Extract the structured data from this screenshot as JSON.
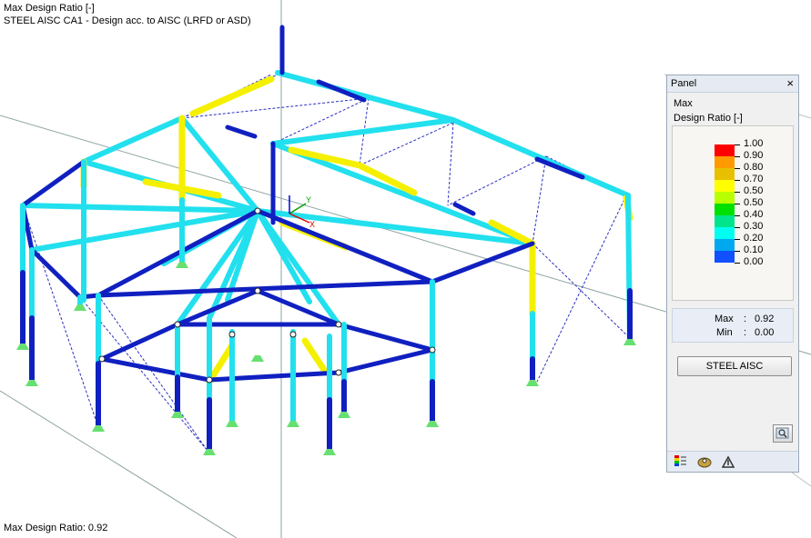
{
  "viewport": {
    "header_line1": "Max Design Ratio [-]",
    "header_line2": "STEEL AISC CA1 - Design acc. to AISC (LRFD or ASD)",
    "footer": "Max Design Ratio: 0.92",
    "axes": {
      "x": "X",
      "y": "Y"
    }
  },
  "panel": {
    "title": "Panel",
    "label1": "Max",
    "label2": "Design Ratio [-]",
    "legend": [
      {
        "value": "1.00",
        "color": "#ff0000"
      },
      {
        "value": "0.90",
        "color": "#ff9a00"
      },
      {
        "value": "0.80",
        "color": "#e8c000"
      },
      {
        "value": "0.70",
        "color": "#ffff00"
      },
      {
        "value": "0.50",
        "color": "#b8ff00"
      },
      {
        "value": "0.50",
        "color": "#00e000"
      },
      {
        "value": "0.40",
        "color": "#00e48c"
      },
      {
        "value": "0.30",
        "color": "#00fff0"
      },
      {
        "value": "0.20",
        "color": "#00a8f0"
      },
      {
        "value": "0.10",
        "color": "#1050ff"
      },
      {
        "value": "0.00",
        "color": "#0a10a8"
      }
    ],
    "max_label": "Max",
    "max_value": "0.92",
    "min_label": "Min",
    "min_value": "0.00",
    "sep": ":",
    "button": "STEEL AISC",
    "tabs": [
      "color-scale-icon",
      "results-icon",
      "settings-icon"
    ]
  }
}
